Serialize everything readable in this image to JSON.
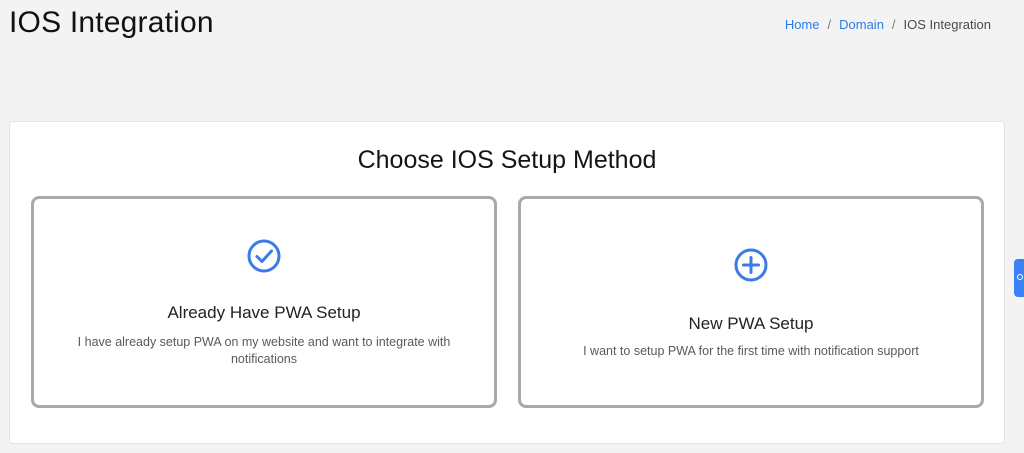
{
  "header": {
    "title": "IOS Integration"
  },
  "breadcrumb": {
    "items": [
      {
        "label": "Home"
      },
      {
        "label": "Domain"
      }
    ],
    "separator": "/",
    "current": "IOS Integration"
  },
  "main": {
    "heading": "Choose IOS Setup Method",
    "options": [
      {
        "icon": "check-circle-icon",
        "title": "Already Have PWA Setup",
        "description": "I have already setup PWA on my website and want to integrate with notifications"
      },
      {
        "icon": "plus-circle-icon",
        "title": "New PWA Setup",
        "description": "I want to setup PWA for the first time with notification support"
      }
    ]
  },
  "colors": {
    "accent": "#2f7be6",
    "icon": "#3b7be8",
    "option_border": "#a9a9a9",
    "side_tab": "#3b82f6",
    "background": "#f3f3f3"
  }
}
